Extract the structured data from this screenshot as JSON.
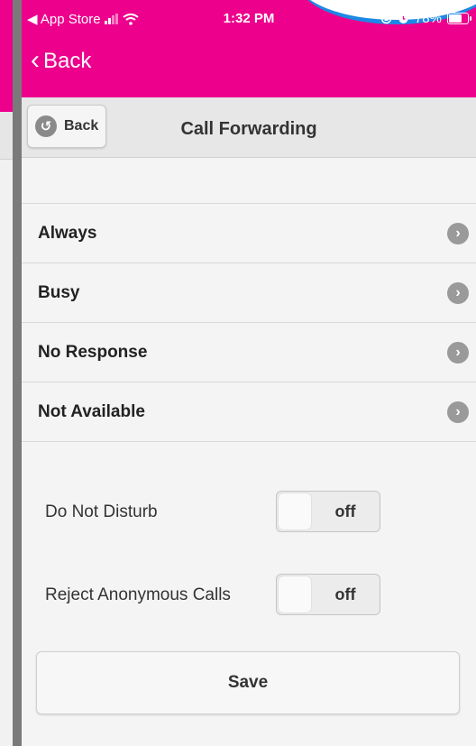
{
  "status_bar": {
    "back_app": "◀ App Store",
    "time": "1:32 PM",
    "battery": "78%",
    "battery_level": 0.78
  },
  "nav": {
    "back_label": "Back"
  },
  "header": {
    "back_button": "Back",
    "title": "Call Forwarding"
  },
  "forward_options": [
    {
      "label": "Always"
    },
    {
      "label": "Busy"
    },
    {
      "label": "No Response"
    },
    {
      "label": "Not Available"
    }
  ],
  "settings": {
    "do_not_disturb": {
      "label": "Do Not Disturb",
      "value": "off"
    },
    "reject_anonymous": {
      "label": "Reject Anonymous Calls",
      "value": "off"
    }
  },
  "save_label": "Save",
  "colors": {
    "brand": "#ec008c",
    "accent": "#1e88e5"
  }
}
